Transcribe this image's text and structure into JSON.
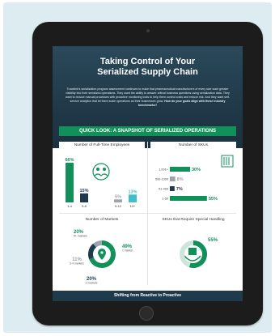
{
  "page": {
    "title_line1": "Taking Control of Your",
    "title_line2": "Serialized Supply Chain",
    "intro_part1": "Tracelink's serialization program assessment continues to make that pharmaceutical manufacturers of every size want greater visibility into their serialized operations. They want the ability to answer critical business questions using serialization data. They want to reduce manual processes with proactive monitoring tools to help them control costs and reduce risk. And they want self-service analytics that let them scale operations as their businesses grow.",
    "intro_part2": "How do your goals align with these industry benchmarks?",
    "quicklook": "QUICK LOOK: A SNAPSHOT OF SERIALIZED OPERATIONS",
    "footer": "Shifting from Reactive to Proactive"
  },
  "colors": {
    "green": "#12905a",
    "dark_green": "#0f7a4a",
    "teal": "#3fbfc9",
    "navy": "#1f3a4a",
    "gray": "#9aa4aa"
  },
  "panels": {
    "employees": {
      "title": "Number of Full-Time Employees",
      "icon": "people-icon"
    },
    "skus": {
      "title": "Number of SKUs",
      "icon": "barcode-icon"
    },
    "markets": {
      "title": "Number of Markets",
      "icon": "location-pin-icon"
    },
    "handling": {
      "title": "SKUs that Require Special Handling",
      "icon": "hands-box-icon"
    }
  },
  "chart_data": [
    {
      "type": "bar",
      "title": "Number of Full-Time Employees",
      "categories": [
        "1-4",
        "5-8",
        "9-12",
        "13+"
      ],
      "values": [
        66,
        15,
        5,
        13
      ],
      "value_labels": [
        "66%",
        "15%",
        "5%",
        "13%"
      ]
    },
    {
      "type": "bar",
      "title": "Number of SKUs",
      "orientation": "horizontal",
      "categories": [
        "1,001+",
        "500-1000",
        "51-499",
        "1-50"
      ],
      "values": [
        30,
        8,
        7,
        55
      ],
      "value_labels": [
        "30%",
        "8%",
        "7%",
        "55%"
      ]
    },
    {
      "type": "pie",
      "title": "Number of Markets",
      "slices": [
        {
          "value": 20,
          "label": "20%",
          "sub": "5+ markets"
        },
        {
          "value": 49,
          "label": "49%",
          "sub": "1 market"
        },
        {
          "value": 20,
          "label": "20%",
          "sub": "2 markets"
        },
        {
          "value": 11,
          "label": "11%",
          "sub": "3-4 markets"
        }
      ]
    },
    {
      "type": "pie",
      "title": "SKUs that Require Special Handling",
      "slices": [
        {
          "value": 55,
          "label": "55%"
        },
        {
          "value": 45
        }
      ]
    }
  ]
}
